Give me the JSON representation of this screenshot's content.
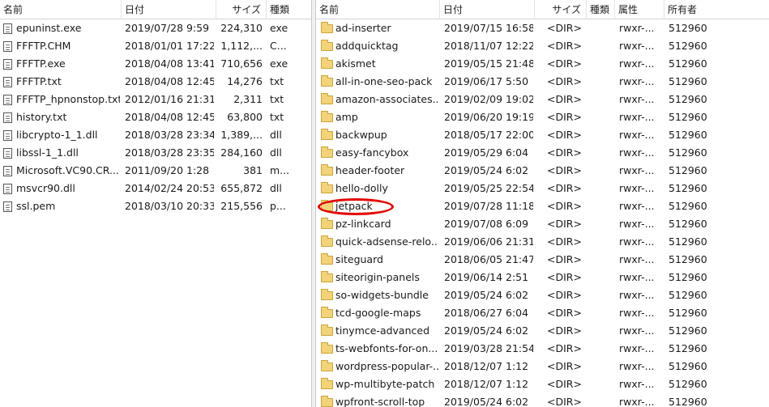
{
  "left": {
    "headers": {
      "name": "名前",
      "date": "日付",
      "size": "サイズ",
      "type": "種類"
    },
    "files": [
      {
        "name": "epuninst.exe",
        "date": "2019/07/28  9:59",
        "size": "224,310",
        "type": "exe"
      },
      {
        "name": "FFFTP.CHM",
        "date": "2018/01/01 17:22",
        "size": "1,112,...",
        "type": "C..."
      },
      {
        "name": "FFFTP.exe",
        "date": "2018/04/08 13:41",
        "size": "710,656",
        "type": "exe"
      },
      {
        "name": "FFFTP.txt",
        "date": "2018/04/08 12:45",
        "size": "14,276",
        "type": "txt"
      },
      {
        "name": "FFFTP_hpnonstop.txt",
        "date": "2012/01/16 21:31",
        "size": "2,311",
        "type": "txt"
      },
      {
        "name": "history.txt",
        "date": "2018/04/08 12:45",
        "size": "63,800",
        "type": "txt"
      },
      {
        "name": "libcrypto-1_1.dll",
        "date": "2018/03/28 23:34",
        "size": "1,389,...",
        "type": "dll"
      },
      {
        "name": "libssl-1_1.dll",
        "date": "2018/03/28 23:35",
        "size": "284,160",
        "type": "dll"
      },
      {
        "name": "Microsoft.VC90.CR...",
        "date": "2011/09/20  1:28",
        "size": "381",
        "type": "m..."
      },
      {
        "name": "msvcr90.dll",
        "date": "2014/02/24 20:53",
        "size": "655,872",
        "type": "dll"
      },
      {
        "name": "ssl.pem",
        "date": "2018/03/10 20:33",
        "size": "215,556",
        "type": "p..."
      }
    ]
  },
  "right": {
    "headers": {
      "name": "名前",
      "date": "日付",
      "size": "サイズ",
      "type": "種類",
      "attr": "属性",
      "owner": "所有者"
    },
    "folders": [
      {
        "name": "ad-inserter",
        "date": "2019/07/15 16:58",
        "size": "<DIR>",
        "attr": "rwxr-...",
        "owner": "512960"
      },
      {
        "name": "addquicktag",
        "date": "2018/11/07 12:22",
        "size": "<DIR>",
        "attr": "rwxr-...",
        "owner": "512960"
      },
      {
        "name": "akismet",
        "date": "2019/05/15 21:48",
        "size": "<DIR>",
        "attr": "rwxr-...",
        "owner": "512960"
      },
      {
        "name": "all-in-one-seo-pack",
        "date": "2019/06/17  5:50",
        "size": "<DIR>",
        "attr": "rwxr-...",
        "owner": "512960"
      },
      {
        "name": "amazon-associates...",
        "date": "2019/02/09 19:02",
        "size": "<DIR>",
        "attr": "rwxr-...",
        "owner": "512960"
      },
      {
        "name": "amp",
        "date": "2019/06/20 19:19",
        "size": "<DIR>",
        "attr": "rwxr-...",
        "owner": "512960"
      },
      {
        "name": "backwpup",
        "date": "2018/05/17 22:00",
        "size": "<DIR>",
        "attr": "rwxr-...",
        "owner": "512960"
      },
      {
        "name": "easy-fancybox",
        "date": "2019/05/29  6:04",
        "size": "<DIR>",
        "attr": "rwxr-...",
        "owner": "512960"
      },
      {
        "name": "header-footer",
        "date": "2019/05/24  6:02",
        "size": "<DIR>",
        "attr": "rwxr-...",
        "owner": "512960"
      },
      {
        "name": "hello-dolly",
        "date": "2019/05/25 22:54",
        "size": "<DIR>",
        "attr": "rwxr-...",
        "owner": "512960"
      },
      {
        "name": "jetpack",
        "date": "2019/07/28 11:18",
        "size": "<DIR>",
        "attr": "rwxr-...",
        "owner": "512960",
        "highlighted": true
      },
      {
        "name": "pz-linkcard",
        "date": "2019/07/08  6:09",
        "size": "<DIR>",
        "attr": "rwxr-...",
        "owner": "512960"
      },
      {
        "name": "quick-adsense-relo...",
        "date": "2019/06/06 21:31",
        "size": "<DIR>",
        "attr": "rwxr-...",
        "owner": "512960"
      },
      {
        "name": "siteguard",
        "date": "2018/06/05 21:47",
        "size": "<DIR>",
        "attr": "rwxr-...",
        "owner": "512960"
      },
      {
        "name": "siteorigin-panels",
        "date": "2019/06/14  2:51",
        "size": "<DIR>",
        "attr": "rwxr-...",
        "owner": "512960"
      },
      {
        "name": "so-widgets-bundle",
        "date": "2019/05/24  6:02",
        "size": "<DIR>",
        "attr": "rwxr-...",
        "owner": "512960"
      },
      {
        "name": "tcd-google-maps",
        "date": "2018/06/27  6:04",
        "size": "<DIR>",
        "attr": "rwxr-...",
        "owner": "512960"
      },
      {
        "name": "tinymce-advanced",
        "date": "2019/05/24  6:02",
        "size": "<DIR>",
        "attr": "rwxr-...",
        "owner": "512960"
      },
      {
        "name": "ts-webfonts-for-on...",
        "date": "2019/03/28 21:54",
        "size": "<DIR>",
        "attr": "rwxr-...",
        "owner": "512960"
      },
      {
        "name": "wordpress-popular-...",
        "date": "2018/12/07  1:12",
        "size": "<DIR>",
        "attr": "rwxr-...",
        "owner": "512960"
      },
      {
        "name": "wp-multibyte-patch",
        "date": "2018/12/07  1:12",
        "size": "<DIR>",
        "attr": "rwxr-...",
        "owner": "512960"
      },
      {
        "name": "wpfront-scroll-top",
        "date": "2019/05/24  6:02",
        "size": "<DIR>",
        "attr": "rwxr-...",
        "owner": "512960"
      }
    ]
  },
  "icons": {
    "file": "file-icon",
    "folder": "folder-icon"
  },
  "colors": {
    "highlight": "#e30000",
    "folder": "#f2d37a"
  }
}
